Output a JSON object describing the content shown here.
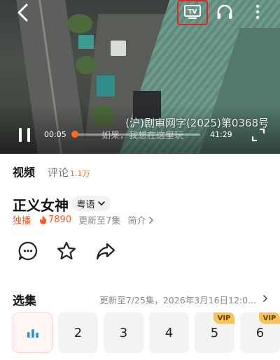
{
  "player": {
    "license_text": "(沪)剧审网字(2025)第0368号",
    "subtitle_text": "如果，我想在这里玩",
    "current_time": "00:05",
    "total_time": "41:29",
    "progress": 0.006,
    "top_icons": [
      "back-arrow-icon",
      "tv-cast-icon",
      "headphone-icon",
      "more-vertical-icon"
    ],
    "cast_highlight_color": "#e52121",
    "progress_color": "#ff6a1a"
  },
  "tabs": {
    "video_label": "视频",
    "comment_label": "评论",
    "comment_count": "1.1万"
  },
  "show": {
    "title": "正义女神",
    "language": "粤语",
    "exclusive": "独播",
    "heat": "7890",
    "updated": "更新至7集",
    "intro": "简介"
  },
  "actions": [
    "comment-icon",
    "favorite-star-icon",
    "share-icon"
  ],
  "episodes": {
    "section_title": "选集",
    "update_info": "更新至7/25集，2026年3月16日12:0...",
    "vip_label": "VIP",
    "items": [
      {
        "label": "",
        "active": true,
        "vip": false
      },
      {
        "label": "2",
        "active": false,
        "vip": false
      },
      {
        "label": "3",
        "active": false,
        "vip": false
      },
      {
        "label": "4",
        "active": false,
        "vip": false
      },
      {
        "label": "5",
        "active": false,
        "vip": true
      },
      {
        "label": "6",
        "active": false,
        "vip": true
      }
    ]
  }
}
